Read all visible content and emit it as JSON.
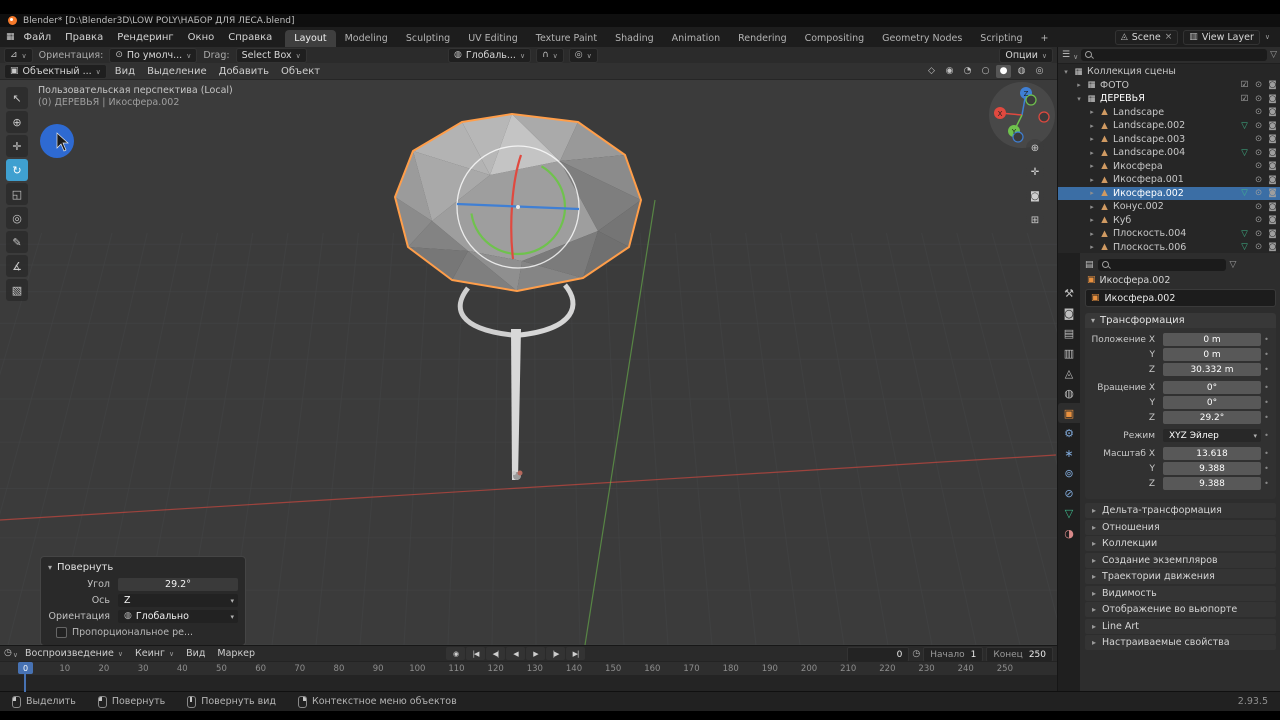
{
  "colors": {
    "accent": "#4772b3",
    "selection_outline": "#ff9e4a",
    "active_tool": "#3fa0d0",
    "axis_x": "#e0493f",
    "axis_y": "#6fc24d",
    "axis_z": "#3f7fd4",
    "selected_row": "#3b6ea5"
  },
  "titlebar": {
    "title": "Blender* [D:\\Blender3D\\LOW POLY\\НАБОР ДЛЯ ЛЕСА.blend]"
  },
  "menubar": {
    "menus": [
      "Файл",
      "Правка",
      "Рендеринг",
      "Окно",
      "Справка"
    ],
    "workspaces": [
      {
        "label": "Layout",
        "active": true
      },
      {
        "label": "Modeling"
      },
      {
        "label": "Sculpting"
      },
      {
        "label": "UV Editing"
      },
      {
        "label": "Texture Paint"
      },
      {
        "label": "Shading"
      },
      {
        "label": "Animation"
      },
      {
        "label": "Rendering"
      },
      {
        "label": "Compositing"
      },
      {
        "label": "Geometry Nodes"
      },
      {
        "label": "Scripting"
      },
      {
        "label": "+"
      }
    ],
    "scene": {
      "label": "Scene"
    },
    "view_layer": {
      "label": "View Layer"
    }
  },
  "toolrow": {
    "orientation_label": "Ориентация:",
    "pivot_value": "По умолч...",
    "drag_label": "Drag:",
    "drag_value": "Select Box",
    "transform_orientation": "Глобаль...",
    "options_label": "Опции"
  },
  "viewport": {
    "header": {
      "mode": "Объектный ...",
      "menus": [
        "Вид",
        "Выделение",
        "Добавить",
        "Объект"
      ],
      "right_icons": [
        {
          "icon": "gizmo"
        },
        {
          "icon": "overlays"
        },
        {
          "icon": "xray"
        },
        {
          "icon": "shade-wire"
        },
        {
          "icon": "shade-solid",
          "active": true
        },
        {
          "icon": "shade-mat"
        },
        {
          "icon": "shade-render"
        }
      ]
    },
    "overlay": {
      "line1": "Пользовательская перспектива (Local)",
      "line2": "(0) ДЕРЕВЬЯ | Икосфера.002"
    },
    "tools": [
      {
        "icon": "select-box"
      },
      {
        "icon": "cursor"
      },
      {
        "icon": "move"
      },
      {
        "icon": "rotate",
        "active": true
      },
      {
        "icon": "scale"
      },
      {
        "icon": "transform"
      },
      {
        "icon": "annotate"
      },
      {
        "icon": "measure"
      },
      {
        "icon": "add-cube"
      }
    ],
    "side_icons": [
      "zoom",
      "pan",
      "camera",
      "ortho"
    ],
    "nav_gizmo": {
      "x_label": "X",
      "y_label": "Y",
      "z_label": "Z"
    }
  },
  "operator_panel": {
    "title": "Повернуть",
    "rows": [
      {
        "label": "Угол",
        "value": "29.2°"
      },
      {
        "label": "Ось",
        "value": "Z",
        "dropdown": true
      },
      {
        "label": "Ориентация",
        "value": "Глобально",
        "dropdown": true,
        "icon": "orient-global"
      }
    ],
    "checkbox_label": "Пропорциональное ре..."
  },
  "timeline": {
    "menus": [
      {
        "label": "Воспроизведение",
        "caret": true
      },
      {
        "label": "Кеинг",
        "caret": true
      },
      {
        "label": "Вид"
      },
      {
        "label": "Маркер"
      }
    ],
    "transport": [
      "autokey",
      "jump-start",
      "key-prev",
      "play-rev",
      "play",
      "key-next",
      "jump-end"
    ],
    "current_frame": "0",
    "start_label": "Начало",
    "start_value": "1",
    "end_label": "Конец",
    "end_value": "250",
    "ticks": [
      "0",
      "10",
      "20",
      "30",
      "40",
      "50",
      "60",
      "70",
      "80",
      "90",
      "100",
      "110",
      "120",
      "130",
      "140",
      "150",
      "160",
      "170",
      "180",
      "190",
      "200",
      "210",
      "220",
      "230",
      "240",
      "250"
    ]
  },
  "outliner": {
    "rows": [
      {
        "indent": 0,
        "tw": "▾",
        "icon": "scene-collection",
        "label": "Коллекция сцены"
      },
      {
        "indent": 1,
        "tw": "▸",
        "icon": "collection",
        "label": "ФОТО",
        "chk": true,
        "eye": true,
        "cam": true
      },
      {
        "indent": 1,
        "tw": "▾",
        "icon": "collection",
        "label": "ДЕРЕВЬЯ",
        "chk": true,
        "eye": true,
        "cam": true,
        "cls": "activecol"
      },
      {
        "indent": 2,
        "tw": "▸",
        "icon": "mesh",
        "label": "Landscape",
        "eye": true,
        "cam": true
      },
      {
        "indent": 2,
        "tw": "▸",
        "icon": "mesh",
        "label": "Landscape.002",
        "data": true,
        "eye": true,
        "cam": true
      },
      {
        "indent": 2,
        "tw": "▸",
        "icon": "mesh",
        "label": "Landscape.003",
        "eye": true,
        "cam": true
      },
      {
        "indent": 2,
        "tw": "▸",
        "icon": "mesh",
        "label": "Landscape.004",
        "data": true,
        "eye": true,
        "cam": true
      },
      {
        "indent": 2,
        "tw": "▸",
        "icon": "mesh",
        "label": "Икосфера",
        "eye": true,
        "cam": true
      },
      {
        "indent": 2,
        "tw": "▸",
        "icon": "mesh",
        "label": "Икосфера.001",
        "eye": true,
        "cam": true
      },
      {
        "indent": 2,
        "tw": "▸",
        "icon": "mesh",
        "label": "Икосфера.002",
        "data": true,
        "eye": true,
        "cam": true,
        "selected": true
      },
      {
        "indent": 2,
        "tw": "▸",
        "icon": "mesh",
        "label": "Конус.002",
        "eye": true,
        "cam": true
      },
      {
        "indent": 2,
        "tw": "▸",
        "icon": "mesh",
        "label": "Куб",
        "eye": true,
        "cam": true
      },
      {
        "indent": 2,
        "tw": "▸",
        "icon": "mesh",
        "label": "Плоскость.004",
        "data": true,
        "eye": true,
        "cam": true
      },
      {
        "indent": 2,
        "tw": "▸",
        "icon": "mesh",
        "label": "Плоскость.006",
        "data": true,
        "eye": true,
        "cam": true
      }
    ]
  },
  "properties": {
    "tabs": [
      {
        "icon": "tool"
      },
      {
        "icon": "render"
      },
      {
        "icon": "output"
      },
      {
        "icon": "view-layer"
      },
      {
        "icon": "scene"
      },
      {
        "icon": "world"
      },
      {
        "icon": "object",
        "active": true
      },
      {
        "icon": "modifiers"
      },
      {
        "icon": "particles"
      },
      {
        "icon": "physics"
      },
      {
        "icon": "constraints"
      },
      {
        "icon": "data"
      },
      {
        "icon": "material"
      }
    ],
    "breadcrumb": "Икосфера.002",
    "name_value": "Икосфера.002",
    "transform": {
      "title": "Трансформация",
      "rows": [
        {
          "label": "Положение X",
          "value": "0 m"
        },
        {
          "label": "Y",
          "value": "0 m"
        },
        {
          "label": "Z",
          "value": "30.332 m"
        },
        {
          "label": "Вращение X",
          "value": "0°",
          "cls": "gap"
        },
        {
          "label": "Y",
          "value": "0°"
        },
        {
          "label": "Z",
          "value": "29.2°"
        },
        {
          "label": "Режим",
          "value": "XYZ Эйлер",
          "cls": "gap",
          "dropdown": true
        },
        {
          "label": "Масштаб X",
          "value": "13.618",
          "cls": "gap"
        },
        {
          "label": "Y",
          "value": "9.388"
        },
        {
          "label": "Z",
          "value": "9.388"
        }
      ]
    },
    "sections": [
      "Дельта-трансформация",
      "Отношения",
      "Коллекции",
      "Создание экземпляров",
      "Траектории движения",
      "Видимость",
      "Отображение во вьюпорте",
      "Line Art",
      "Настраиваемые свойства"
    ]
  },
  "statusbar": {
    "items": [
      {
        "mouse": "lmb",
        "label": "Выделить"
      },
      {
        "mouse": "lmb",
        "label": "Повернуть"
      },
      {
        "mouse": "mmb",
        "label": "Повернуть вид"
      },
      {
        "mouse": "rmb",
        "label": "Контекстное меню объектов"
      }
    ],
    "version": "2.93.5"
  }
}
